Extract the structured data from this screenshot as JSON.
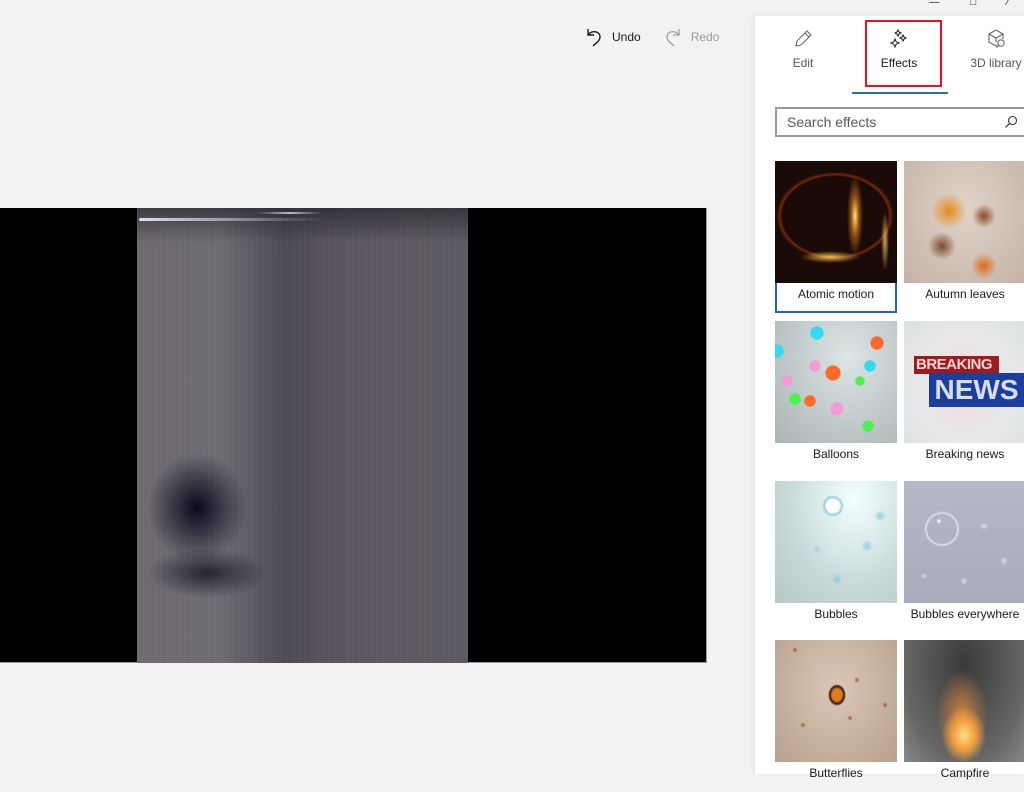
{
  "toolbar": {
    "undo_label": "Undo",
    "redo_label": "Redo",
    "undo_icon": "undo-icon",
    "redo_icon": "redo-icon",
    "redo_enabled": false
  },
  "window_controls": {
    "minimize": "minimize-icon",
    "maximize": "maximize-icon",
    "close": "close-icon"
  },
  "panel": {
    "tabs": [
      {
        "label": "Edit",
        "icon": "pencil-icon",
        "active": false
      },
      {
        "label": "Effects",
        "icon": "sparkles-icon",
        "active": true
      },
      {
        "label": "3D library",
        "icon": "3d-library-icon",
        "active": false
      }
    ],
    "search": {
      "placeholder": "Search effects",
      "value": "",
      "icon": "search-icon"
    },
    "effects": [
      {
        "label": "Atomic motion",
        "selected": true
      },
      {
        "label": "Autumn leaves",
        "selected": false
      },
      {
        "label": "Balloons",
        "selected": false
      },
      {
        "label": "Breaking news",
        "selected": false
      },
      {
        "label": "Bubbles",
        "selected": false
      },
      {
        "label": "Bubbles everywhere",
        "selected": false
      },
      {
        "label": "Butterflies",
        "selected": false
      },
      {
        "label": "Campfire",
        "selected": false
      }
    ],
    "breaking_news_thumb": {
      "line1": "BREAKING",
      "line2": "NEWS"
    }
  },
  "colors": {
    "accent": "#2b6cb0",
    "selection_border": "#1f64b5",
    "highlight_box": "#e81123",
    "panel_bg": "#ffffff",
    "canvas_bg": "#f2f2f2"
  }
}
